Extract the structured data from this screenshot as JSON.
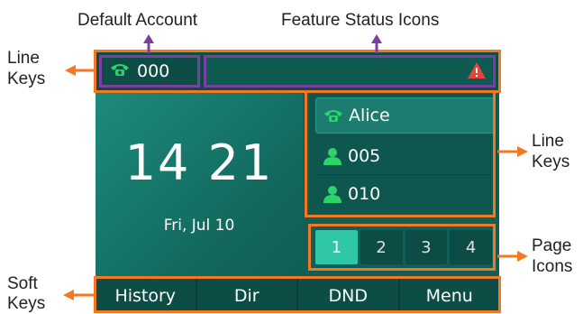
{
  "annotations": {
    "default_account": "Default Account",
    "feature_status_icons": "Feature Status Icons",
    "line_keys_left_1": "Line",
    "line_keys_left_2": "Keys",
    "line_keys_right_1": "Line",
    "line_keys_right_2": "Keys",
    "page_icons_1": "Page",
    "page_icons_2": "Icons",
    "soft_keys_1": "Soft",
    "soft_keys_2": "Keys"
  },
  "screen": {
    "account_number": "000",
    "time": "14 21",
    "date": "Fri, Jul 10",
    "line_keys": [
      {
        "label": "Alice",
        "icon": "phone-icon"
      },
      {
        "label": "005",
        "icon": "contact-icon"
      },
      {
        "label": "010",
        "icon": "contact-icon"
      }
    ],
    "pages": [
      "1",
      "2",
      "3",
      "4"
    ],
    "active_page": "1",
    "soft_keys": [
      "History",
      "Dir",
      "DND",
      "Menu"
    ]
  },
  "colors": {
    "annotation_orange": "#f47721",
    "annotation_purple": "#7b3fa0",
    "screen_green": "#0f5f56",
    "icon_green": "#2ed36b",
    "warning_red": "#e8443a",
    "active_page": "#2fc7a6"
  }
}
